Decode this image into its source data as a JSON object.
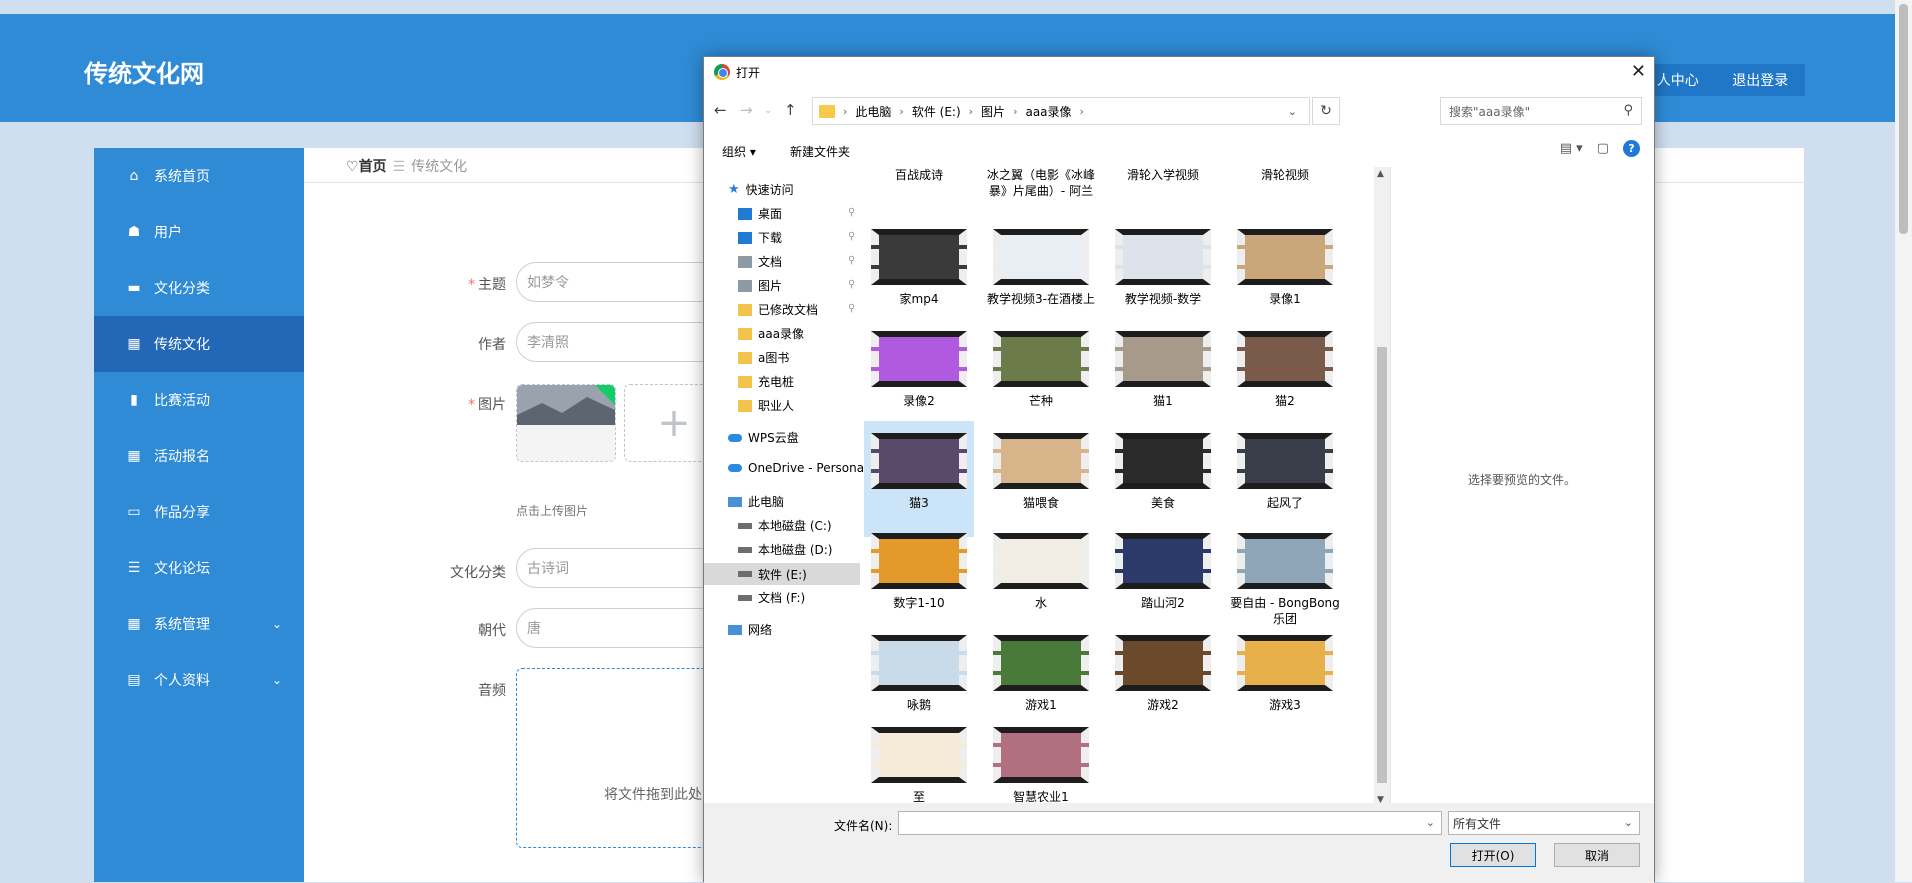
{
  "app": {
    "brand": "传统文化网",
    "user_center": "人中心",
    "logout": "退出登录"
  },
  "sidebar": {
    "items": [
      {
        "label": "系统首页",
        "icon": "home-icon"
      },
      {
        "label": "用户",
        "icon": "user-icon"
      },
      {
        "label": "文化分类",
        "icon": "monitor-icon"
      },
      {
        "label": "传统文化",
        "icon": "grid-icon"
      },
      {
        "label": "比赛活动",
        "icon": "bar-chart-icon"
      },
      {
        "label": "活动报名",
        "icon": "grid-icon"
      },
      {
        "label": "作品分享",
        "icon": "comment-icon"
      },
      {
        "label": "文化论坛",
        "icon": "list-icon"
      },
      {
        "label": "系统管理",
        "icon": "grid-icon"
      },
      {
        "label": "个人资料",
        "icon": "calendar-icon"
      }
    ],
    "active_index": 3
  },
  "breadcrumb": {
    "home": "首页",
    "sep": "☰",
    "current": "传统文化"
  },
  "form": {
    "theme_label": "主题",
    "theme_value": "如梦令",
    "author_label": "作者",
    "author_value": "李清照",
    "image_label": "图片",
    "upload_hint": "点击上传图片",
    "category_label": "文化分类",
    "category_value": "古诗词",
    "dynasty_label": "朝代",
    "dynasty_value": "唐",
    "audio_label": "音频",
    "drop_text": "将文件拖到此处"
  },
  "dialog": {
    "title": "打开",
    "path": [
      "此电脑",
      "软件 (E:)",
      "图片",
      "aaa录像"
    ],
    "search_placeholder": "搜索\"aaa录像\"",
    "organize": "组织 ▾",
    "new_folder": "新建文件夹",
    "nav": {
      "quick_access": "快速访问",
      "quick": [
        "桌面",
        "下载",
        "文档",
        "图片",
        "已修改文档",
        "aaa录像",
        "a图书",
        "充电桩",
        "职业人"
      ],
      "wps": "WPS云盘",
      "onedrive": "OneDrive - Persona",
      "this_pc": "此电脑",
      "drives": [
        "本地磁盘 (C:)",
        "本地磁盘 (D:)",
        "软件 (E:)",
        "文档 (F:)"
      ],
      "network": "网络"
    },
    "header_items": [
      "百战成诗",
      "冰之翼（电影《冰峰暴》片尾曲）- 阿兰",
      "滑轮入学视频",
      "滑轮视频"
    ],
    "files": [
      "家mp4",
      "教学视频3-在酒楼上",
      "教学视频-数学",
      "录像1",
      "录像2",
      "芒种",
      "猫1",
      "猫2",
      "猫3",
      "猫喂食",
      "美食",
      "起风了",
      "数字1-10",
      "水",
      "踏山河2",
      "要自由 - BongBong乐团",
      "咏鹅",
      "游戏1",
      "游戏2",
      "游戏3",
      "至",
      "智慧农业1"
    ],
    "selected_file": "猫3",
    "preview_text": "选择要预览的文件。",
    "filename_label": "文件名(N):",
    "filetype": "所有文件",
    "open_btn": "打开(O)",
    "cancel_btn": "取消"
  }
}
